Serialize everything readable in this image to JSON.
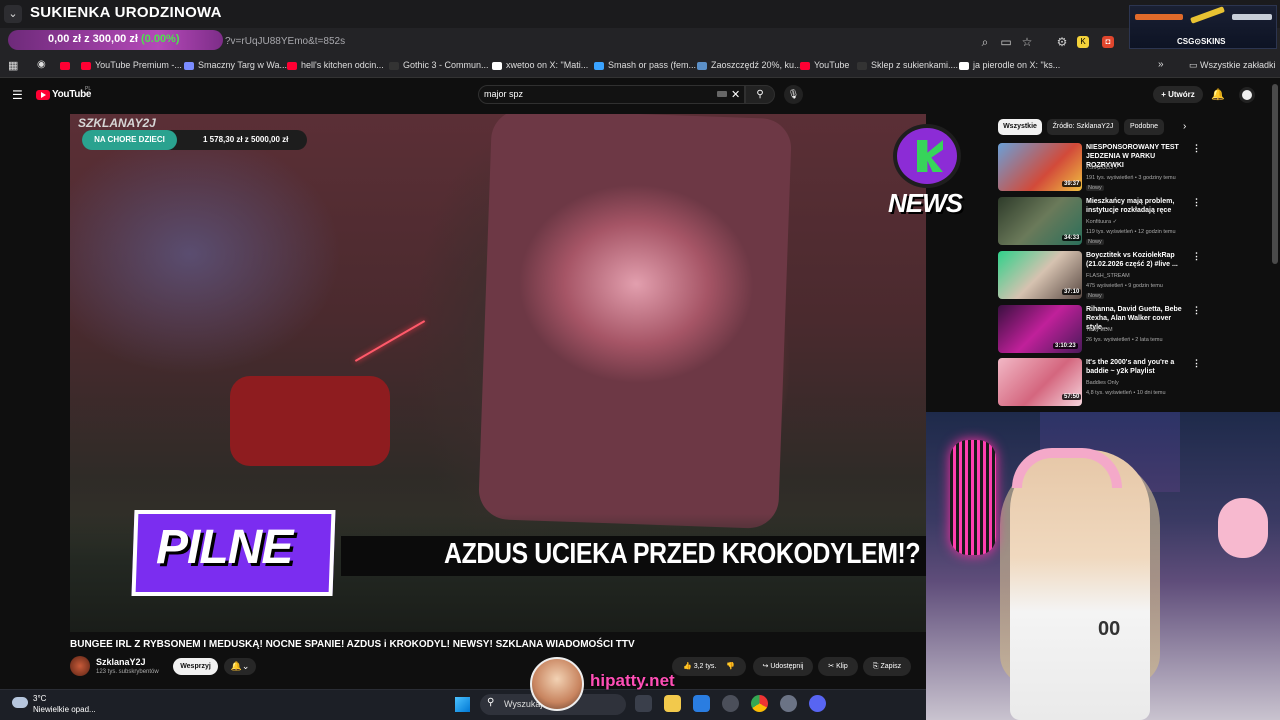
{
  "browser": {
    "overlay_title": "SUKIENKA URODZINOWA",
    "url": "?v=rUqJU88YEmo&t=852s",
    "donation": {
      "raised": "0,00 zł",
      "separator": "z",
      "goal": "300,00 zł",
      "percent": "(0.00%)"
    },
    "bookmarks": [
      {
        "label": "YouTube Premium -...",
        "color": "#ff0033"
      },
      {
        "label": "Smaczny Targ w Wa...",
        "color": "#7b8cff"
      },
      {
        "label": "hell's kitchen odcin...",
        "color": "#ff0033"
      },
      {
        "label": "Gothic 3 - Commun...",
        "color": "#333333"
      },
      {
        "label": "xwetoo on X: \"Mati...",
        "color": "#ffffff"
      },
      {
        "label": "Smash or pass (fem...",
        "color": "#3aa3ff"
      },
      {
        "label": "Zaoszczędź 20%, ku...",
        "color": "#1b2838"
      },
      {
        "label": "YouTube",
        "color": "#ff0033"
      },
      {
        "label": "Sklep z sukienkami....",
        "color": "#333333"
      },
      {
        "label": "ja pierodle on X: \"ks...",
        "color": "#ffffff"
      }
    ],
    "all_bookmarks": "Wszystkie zakładki",
    "csgo_label": "CSG⊙SKINS"
  },
  "youtube": {
    "logo": "YouTube",
    "region": "PL",
    "search_value": "major spz",
    "create_label": "+ Utwórz"
  },
  "video": {
    "channel_logo": "SZKLANAY2J",
    "charity_label": "NA CHORE DZIECI",
    "charity_amount": "1 578,30 zł z 5000,00 zł",
    "news_text": "NEWS",
    "pilne": "PILNE",
    "headline": "AZDUS UCIEKA PRZED KROKODYLEM!?",
    "title": "BUNGEE IRL Z RYBSONEM I MEDUSKĄ! NOCNE SPANIE! AZDUS i KROKODYL! NEWSY! SZKLANA WIADOMOŚCI TTV",
    "channel_name": "SzklanaY2J",
    "subscribers": "123 tys. subskrybentów",
    "support_label": "Wesprzyj",
    "likes": "3,2 tys.",
    "share_label": "Udostępnij",
    "clip_label": "Klip",
    "save_label": "Zapisz"
  },
  "sidebar": {
    "chips": [
      "Wszystkie",
      "Źródło: SzklanaY2J",
      "Podobne"
    ],
    "recommendations": [
      {
        "title": "NIESPONSOROWANY TEST JEDZENIA W PARKU ROZRYWKI",
        "channel": "KSIĄŻULO ✓",
        "meta": "191 tys. wyświetleń • 3 godziny temu",
        "badge": "Nowy",
        "duration": "39:37",
        "thumb": "linear-gradient(135deg,#6aa0d8,#d24a3a 60%,#f0c040)"
      },
      {
        "title": "Mieszkańcy mają problem, instytucje rozkładają ręce",
        "channel": "Konfituura ✓",
        "meta": "119 tys. wyświetleń • 12 godzin temu",
        "badge": "Nowy",
        "duration": "34:33",
        "thumb": "linear-gradient(135deg,#2e3b2a,#6b7a5a 50%,#2a6f5a)"
      },
      {
        "title": "Boycztitek vs KoziolekRap (21.02.2026 część 2) #live ...",
        "channel": "FLASH_STREAM",
        "meta": "475 wyświetleń • 9 godzin temu",
        "badge": "Nowy",
        "duration": "37:10",
        "thumb": "linear-gradient(135deg,#2fd18a,#d6c2b0 50%,#5a4a44)"
      },
      {
        "title": "Rihanna, David Guetta, Bebe Rexha, Alan Walker cover style...",
        "channel": "Tasty EDM",
        "meta": "26 tys. wyświetleń • 2 lata temu",
        "badge": "",
        "duration": "3:10:23",
        "thumb": "linear-gradient(135deg,#3a1040,#c0209a 50%,#4a1a5a)"
      },
      {
        "title": "It's the 2000's and you're a baddie ~ y2k Playlist",
        "channel": "Baddies Only",
        "meta": "4,8 tys. wyświetleń • 10 dni temu",
        "badge": "",
        "duration": "57:50",
        "thumb": "linear-gradient(135deg,#f2b8c6,#d4667e 55%,#f6d5dd)"
      }
    ]
  },
  "webcam": {
    "jersey_number": "00"
  },
  "watermark": {
    "text": "hipatty.net"
  },
  "taskbar": {
    "temperature": "3°C",
    "weather": "Niewielkie opad...",
    "search_placeholder": "Wyszukaj"
  }
}
